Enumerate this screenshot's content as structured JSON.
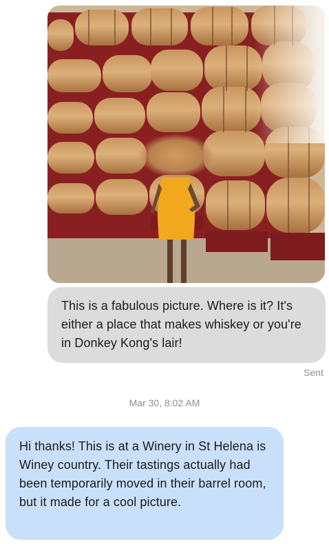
{
  "conversation": {
    "outgoing_message": {
      "text": "This is a fabulous picture. Where is it? It's either a place that makes whiskey or you're in Donkey Kong's lair!",
      "status": "Sent"
    },
    "timestamp": "Mar 30, 8:02 AM",
    "incoming_message": {
      "text": "Hi thanks! This is at a Winery in St Helena is Winey country. Their tastings actually had been temporarily moved in their barrel room, but it made for a cool picture."
    }
  },
  "colors": {
    "outgoing_bubble": "#dcdcdc",
    "incoming_bubble": "#c9e0fb",
    "meta_text": "#8c8c8c",
    "barrel_rack": "#8a1f22",
    "dress": "#f2a81c"
  }
}
